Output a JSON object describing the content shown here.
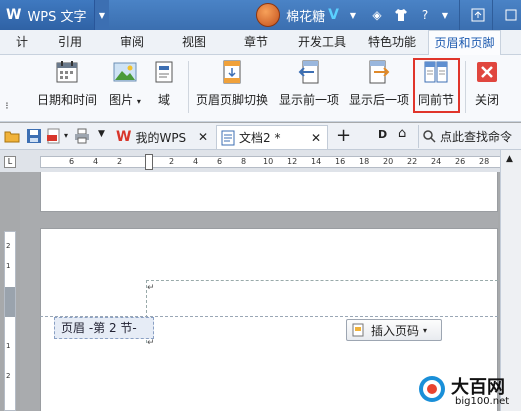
{
  "app": {
    "logo_letter": "W",
    "title": "WPS 文字",
    "user_name": "棉花糖",
    "vip_mark": "V"
  },
  "title_icons": [
    "shirt-icon",
    "help-icon",
    "minimize-to-tray-icon",
    "window-icon"
  ],
  "ribbon_tabs": [
    {
      "label": "引用"
    },
    {
      "label": "审阅"
    },
    {
      "label": "视图"
    },
    {
      "label": "章节"
    },
    {
      "label": "开发工具"
    },
    {
      "label": "特色功能"
    },
    {
      "label": "页眉和页脚"
    }
  ],
  "ribbon_partial_tab": "计",
  "ribbon": {
    "date_time": "日期和时间",
    "picture": "图片",
    "field": "域",
    "header_footer_switch": "页眉页脚切换",
    "show_prev": "显示前一项",
    "show_next": "显示后一项",
    "same_as_prev": "同前节",
    "close": "关闭"
  },
  "doc_tabs": {
    "my_wps": "我的WPS",
    "doc2": "文档2 *",
    "search": "点此查找命令"
  },
  "ruler": {
    "h_ticks": [
      "6",
      "4",
      "2",
      "2",
      "4",
      "6",
      "8",
      "10",
      "12",
      "14",
      "16",
      "18",
      "20",
      "22",
      "24",
      "26",
      "28"
    ],
    "v_ticks": [
      "2",
      "1",
      "1",
      "2"
    ]
  },
  "document": {
    "header_tag": "页眉 -第 2 节-",
    "insert_page_number": "插入页码"
  },
  "watermark": {
    "title": "大百网",
    "url": "big100.net"
  }
}
